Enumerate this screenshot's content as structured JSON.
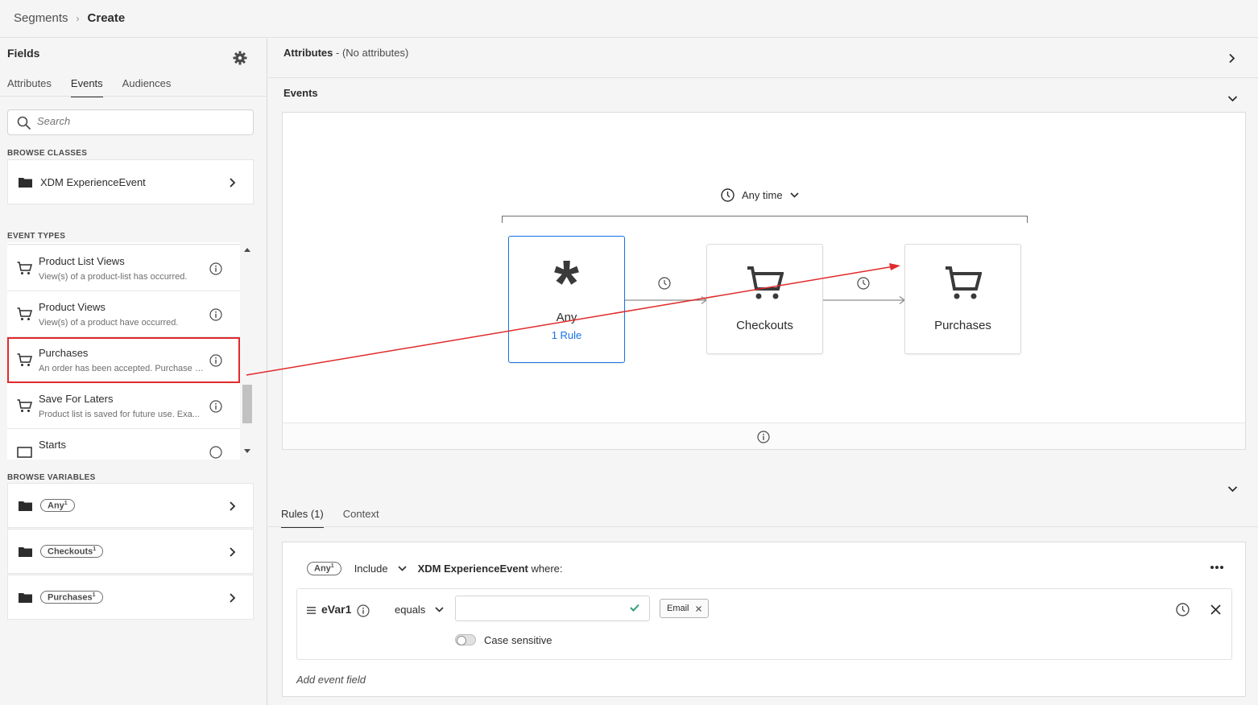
{
  "breadcrumb": {
    "parent": "Segments",
    "separator": "›",
    "current": "Create"
  },
  "fields_panel": {
    "title": "Fields",
    "tabs": [
      {
        "label": "Attributes",
        "active": false
      },
      {
        "label": "Events",
        "active": true
      },
      {
        "label": "Audiences",
        "active": false
      }
    ],
    "search_placeholder": "Search",
    "browse_classes_label": "BROWSE CLASSES",
    "browse_class": "XDM ExperienceEvent",
    "event_types_label": "EVENT TYPES",
    "event_types": [
      {
        "name": "Product List Views",
        "description": "View(s) of a product-list has occurred."
      },
      {
        "name": "Product Views",
        "description": "View(s) of a product have occurred."
      },
      {
        "name": "Purchases",
        "description": "An order has been accepted. Purchase i...",
        "highlighted": true
      },
      {
        "name": "Save For Laters",
        "description": "Product list is saved for future use. Exa..."
      },
      {
        "name": "Starts",
        "description": ""
      }
    ],
    "browse_variables_label": "BROWSE VARIABLES",
    "variables": [
      {
        "label": "Any",
        "sup": "1"
      },
      {
        "label": "Checkouts",
        "sup": "1"
      },
      {
        "label": "Purchases",
        "sup": "1"
      }
    ]
  },
  "attributes": {
    "title": "Attributes",
    "subtitle": " - (No attributes)"
  },
  "events": {
    "title": "Events",
    "time_constraint": "Any time",
    "nodes": [
      {
        "label": "Any",
        "rule": "1 Rule",
        "icon": "asterisk-icon",
        "selected": true
      },
      {
        "label": "Checkouts",
        "icon": "cart-icon"
      },
      {
        "label": "Purchases",
        "icon": "cart-icon"
      }
    ]
  },
  "lower_tabs": [
    {
      "label": "Rules (1)",
      "active": true
    },
    {
      "label": "Context",
      "active": false
    }
  ],
  "rule": {
    "pill": "Any",
    "pill_sup": "1",
    "include": "Include",
    "class_name": "XDM ExperienceEvent",
    "where": " where:",
    "variable": "eVar1",
    "operator": "equals",
    "value": "",
    "tag": "Email",
    "case_sensitive": "Case sensitive",
    "add_field": "Add event field"
  },
  "colors": {
    "accent": "#1473e6",
    "annotation": "#e02a2a",
    "check": "#2d9d78"
  }
}
